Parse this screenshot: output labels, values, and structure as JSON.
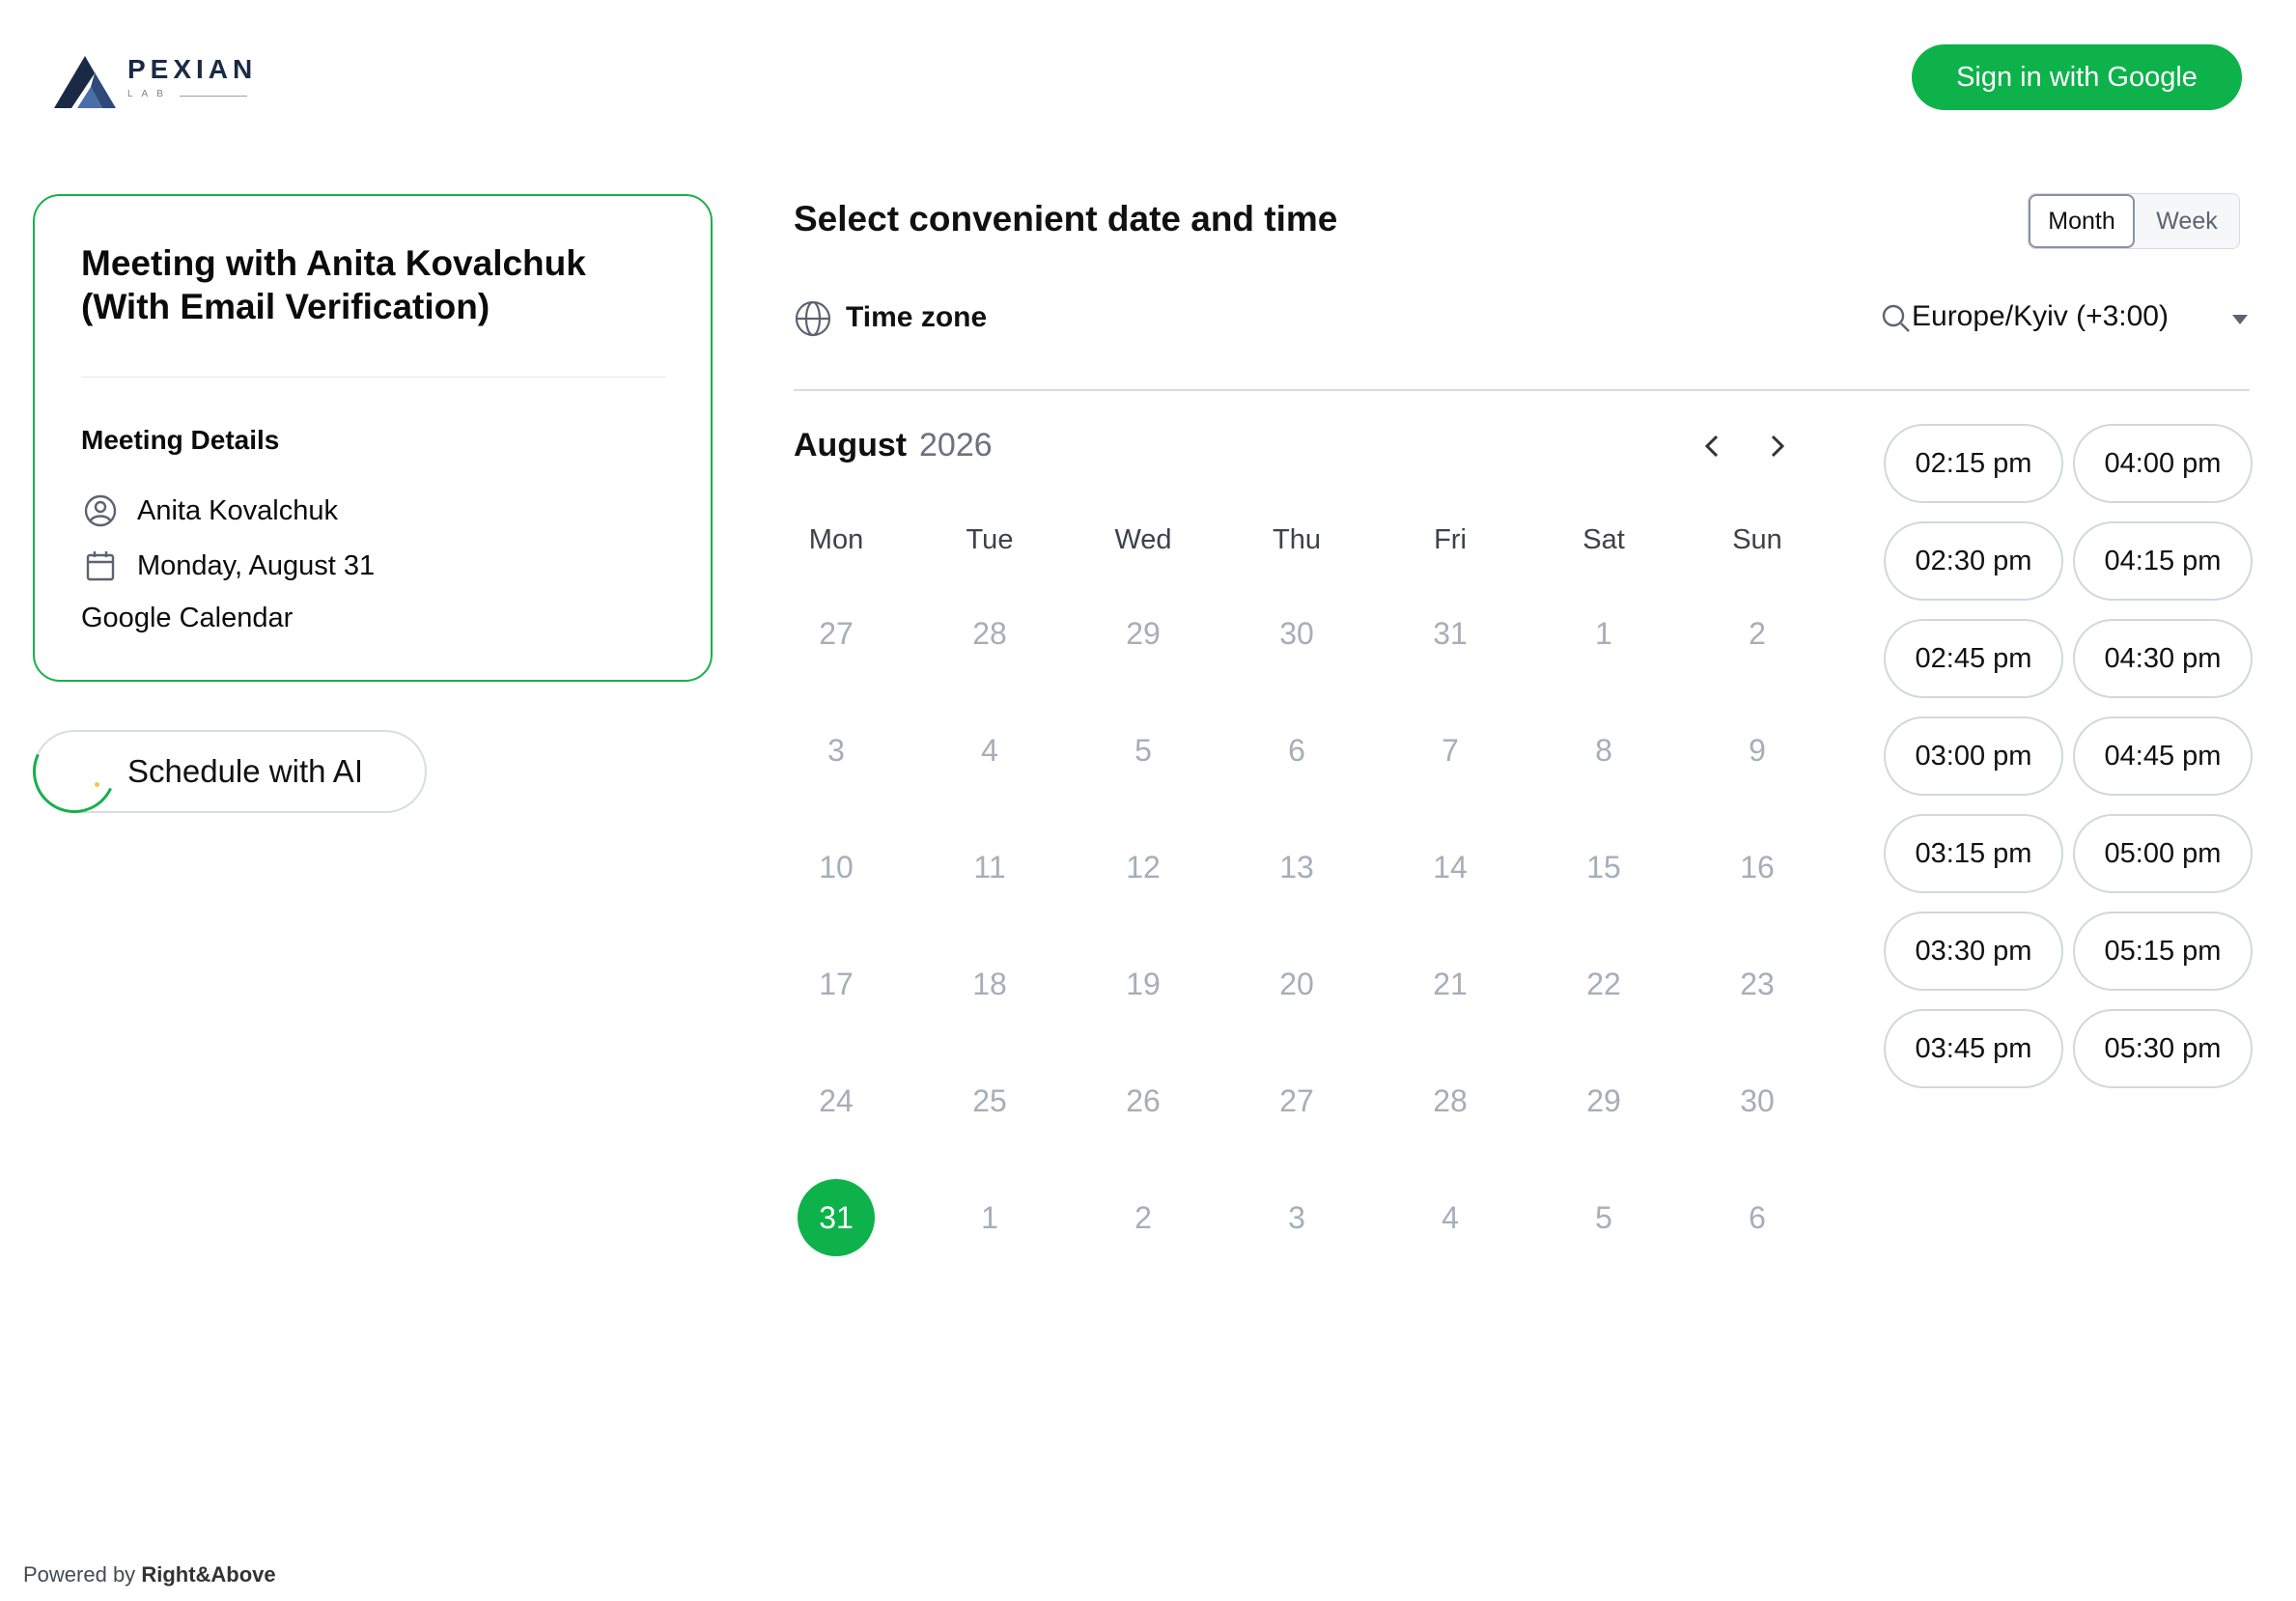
{
  "header": {
    "logo_word": "PEXIAN",
    "logo_sub": "LAB",
    "signin_label": "Sign in with Google"
  },
  "meeting": {
    "title": "Meeting with Anita Kovalchuk (With Email Verification)",
    "details_heading": "Meeting Details",
    "host": "Anita Kovalchuk",
    "date": "Monday, August 31",
    "calendar": "Google Calendar"
  },
  "ai_button": {
    "label": "Schedule with AI"
  },
  "footer": {
    "powered_prefix": "Powered by",
    "powered_brand": "Right&Above"
  },
  "scheduler": {
    "title": "Select convenient date and time",
    "view_toggle": {
      "month": "Month",
      "week": "Week",
      "active": "Month"
    },
    "timezone_label": "Time zone",
    "timezone_value": "Europe/Kyiv (+3:00)"
  },
  "calendar": {
    "month": "August",
    "year": "2026",
    "weekdays": [
      "Mon",
      "Tue",
      "Wed",
      "Thu",
      "Fri",
      "Sat",
      "Sun"
    ],
    "weeks": [
      [
        "27",
        "28",
        "29",
        "30",
        "31",
        "1",
        "2"
      ],
      [
        "3",
        "4",
        "5",
        "6",
        "7",
        "8",
        "9"
      ],
      [
        "10",
        "11",
        "12",
        "13",
        "14",
        "15",
        "16"
      ],
      [
        "17",
        "18",
        "19",
        "20",
        "21",
        "22",
        "23"
      ],
      [
        "24",
        "25",
        "26",
        "27",
        "28",
        "29",
        "30"
      ],
      [
        "31",
        "1",
        "2",
        "3",
        "4",
        "5",
        "6"
      ]
    ],
    "selected": "31"
  },
  "time_slots": [
    [
      "02:15 pm",
      "04:00 pm"
    ],
    [
      "02:30 pm",
      "04:15 pm"
    ],
    [
      "02:45 pm",
      "04:30 pm"
    ],
    [
      "03:00 pm",
      "04:45 pm"
    ],
    [
      "03:15 pm",
      "05:00 pm"
    ],
    [
      "03:30 pm",
      "05:15 pm"
    ],
    [
      "03:45 pm",
      "05:30 pm"
    ]
  ],
  "colors": {
    "accent": "#0db24a",
    "muted_day": "#a7aeb8",
    "brand_navy": "#1b2a44"
  }
}
